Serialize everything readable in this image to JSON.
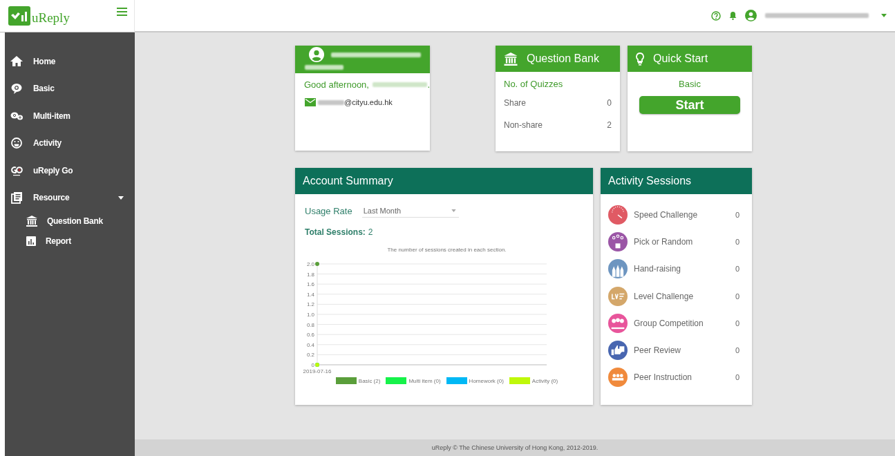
{
  "logo": {
    "text": "uReply"
  },
  "sidebar": {
    "items": [
      {
        "label": "Home"
      },
      {
        "label": "Basic"
      },
      {
        "label": "Multi-item"
      },
      {
        "label": "Activity"
      },
      {
        "label": "uReply Go"
      },
      {
        "label": "Resource",
        "expanded": true,
        "children": [
          {
            "label": "Question Bank"
          },
          {
            "label": "Report"
          }
        ]
      }
    ]
  },
  "profile_card": {
    "greeting": "Good afternoon,",
    "greeting_end": ".",
    "email": "@cityu.edu.hk"
  },
  "question_bank": {
    "title": "Question Bank",
    "subtitle": "No. of Quizzes",
    "rows": [
      {
        "label": "Share",
        "value": "0"
      },
      {
        "label": "Non-share",
        "value": "2"
      }
    ]
  },
  "quick_start": {
    "title": "Quick Start",
    "mode": "Basic",
    "button": "Start"
  },
  "account_summary": {
    "title": "Account Summary",
    "usage_label": "Usage Rate",
    "period": "Last Month",
    "total_label": "Total Sessions:",
    "total": "2",
    "chart_data": {
      "type": "line",
      "grid": true,
      "legend": "bottom",
      "title": "The number of sessions created in each section.",
      "x": [
        "2019-07-16"
      ],
      "ylim": [
        0,
        2
      ],
      "yticks": [
        {
          "value": 0,
          "label": "0"
        },
        {
          "value": 0.2,
          "label": "0.2"
        },
        {
          "value": 0.4,
          "label": "0.4"
        },
        {
          "value": 0.6,
          "label": "0.6"
        },
        {
          "value": 0.8,
          "label": "0.8"
        },
        {
          "value": 1,
          "label": "1.0"
        },
        {
          "value": 1.2,
          "label": "1.2"
        },
        {
          "value": 1.4,
          "label": "1.4"
        },
        {
          "value": 1.6,
          "label": "1.6"
        },
        {
          "value": 1.8,
          "label": "1.8"
        },
        {
          "value": 2,
          "label": "2.0"
        }
      ],
      "series": [
        {
          "name": "Basic (2)",
          "color": "#5a9e3a",
          "marker": "circle",
          "values": [
            2
          ]
        },
        {
          "name": "Multi item (0)",
          "color": "#16f24a",
          "marker": "circle",
          "values": [
            0
          ]
        },
        {
          "name": "Homework (0)",
          "color": "#00b8f5",
          "marker": "circle",
          "values": [
            0
          ]
        },
        {
          "name": "Activity (0)",
          "color": "#bff80a",
          "marker": "circle",
          "values": [
            0
          ]
        }
      ]
    }
  },
  "activity_sessions": {
    "title": "Activity Sessions",
    "items": [
      {
        "name": "Speed Challenge",
        "count": "0",
        "color": "#e05a64"
      },
      {
        "name": "Pick or Random",
        "count": "0",
        "color": "#9b56a6"
      },
      {
        "name": "Hand-raising",
        "count": "0",
        "color": "#6d95c0"
      },
      {
        "name": "Level Challenge",
        "count": "0",
        "color": "#d4a76a"
      },
      {
        "name": "Group Competition",
        "count": "0",
        "color": "#e8559b"
      },
      {
        "name": "Peer Review",
        "count": "0",
        "color": "#4866b0"
      },
      {
        "name": "Peer Instruction",
        "count": "0",
        "color": "#f08a3c"
      }
    ]
  },
  "footer": {
    "text": "uReply © The Chinese University of Hong Kong, 2012-2019."
  }
}
